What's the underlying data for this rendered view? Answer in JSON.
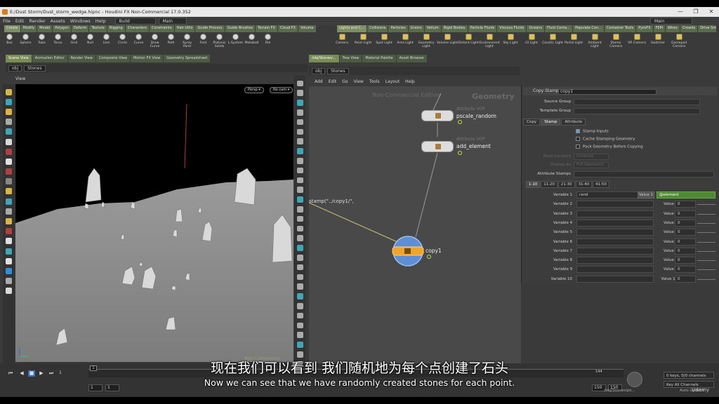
{
  "window": {
    "title": "E:/Dust Storm/Dust_storm_wedge.hipnc - Houdini FX Non-Commercial 17.0.352",
    "controls": [
      "—",
      "❐",
      "✕"
    ]
  },
  "menu": {
    "items": [
      "File",
      "Edit",
      "Render",
      "Assets",
      "Windows",
      "Help"
    ],
    "desktop": "Build",
    "desktop2": "Main"
  },
  "shelf_left": {
    "tabs": [
      "Create",
      "Modify",
      "Model",
      "Polygon",
      "Deform",
      "Texture",
      "Rigging",
      "Characters",
      "Constraints",
      "Hair Utils",
      "Guide Process",
      "Guide Brushes",
      "Terrain FX",
      "Cloud FX",
      "Volume"
    ],
    "tools": [
      "Box",
      "Sphere",
      "Tube",
      "Torus",
      "Grid",
      "Null",
      "Line",
      "Circle",
      "Curve",
      "Draw Curve",
      "Path",
      "Spray Paint",
      "Font",
      "Platonic Solids",
      "L-System",
      "Metaball",
      "File"
    ]
  },
  "shelf_right": {
    "tabs": [
      "Lights and C...",
      "Collisions",
      "Particles",
      "Grains",
      "Vellum",
      "Rigid Bodies",
      "Particle Fluids",
      "Viscous Fluids",
      "Oceans",
      "Fluid Conta...",
      "Populate Con...",
      "Container Tools",
      "PyroFX",
      "FEM",
      "Wires",
      "Crowds",
      "Drive Simula..."
    ],
    "tools": [
      "Camera",
      "Point Light",
      "Spot Light",
      "Area Light",
      "Geometry Light",
      "Volume Light",
      "Distant Light",
      "Environment Light",
      "Sky Light",
      "GI Light",
      "Caustic Light",
      "Portal Light",
      "Ambient Light",
      "Stereo Camera",
      "VR Camera",
      "Switcher",
      "Gamepad Camera"
    ]
  },
  "left_panes": {
    "tabs": [
      "Scene View",
      "Animation Editor",
      "Render View",
      "Composite View",
      "Motion FX View",
      "Geometry Spreadsheet"
    ],
    "path": [
      "obj",
      "Stones"
    ],
    "view_label": "View",
    "persp": "Persp ▾",
    "cam": "No cam ▾",
    "watermark": "Non-Commercial Edition"
  },
  "right_panes": {
    "tabs": [
      "/obj/Stones/...",
      "Tree View",
      "Material Palette",
      "Asset Browser"
    ],
    "path": [
      "obj",
      "Stones"
    ],
    "menu": [
      "Add",
      "Edit",
      "Go",
      "View",
      "Tools",
      "Layout",
      "Help"
    ]
  },
  "network": {
    "watermark": "Non-Commercial Edition",
    "context": "Geometry",
    "nodes": [
      {
        "type": "Attribute VOP",
        "name": "pscale_random"
      },
      {
        "type": "Attribute VOP",
        "name": "add_element"
      },
      {
        "type": "",
        "name": "copy1"
      }
    ],
    "expression": "stamp(\"../copy1/\","
  },
  "params": {
    "header": "Copy Stamp",
    "node_name": "copy1",
    "fields": [
      {
        "label": "Source Group",
        "value": ""
      },
      {
        "label": "Template Group",
        "value": ""
      }
    ],
    "tabs": [
      "Copy",
      "Stamp",
      "Attribute"
    ],
    "active_tab": "Stamp",
    "checks": [
      {
        "label": "Stamp Inputs",
        "on": true
      },
      {
        "label": "Cache Stamping Geometry",
        "on": false
      },
      {
        "label": "Pack Geometry Before Copying",
        "on": false
      }
    ],
    "faint": [
      {
        "label": "Pivot Location",
        "value": "Centroid"
      },
      {
        "label": "Display As",
        "value": "Full Geometry"
      }
    ],
    "attr_stamps": "Attribute Stamps",
    "range_tabs": [
      "1-10",
      "11-20",
      "21-30",
      "31-40",
      "41-50"
    ],
    "vars": [
      {
        "label": "Variable 1",
        "name": "rand",
        "vlabel": "Value 1",
        "value": "@element"
      },
      {
        "label": "Variable 2",
        "name": "",
        "vlabel": "Value 2",
        "value": "0"
      },
      {
        "label": "Variable 3",
        "name": "",
        "vlabel": "Value 3",
        "value": "0"
      },
      {
        "label": "Variable 4",
        "name": "",
        "vlabel": "Value 4",
        "value": "0"
      },
      {
        "label": "Variable 5",
        "name": "",
        "vlabel": "Value 5",
        "value": "0"
      },
      {
        "label": "Variable 6",
        "name": "",
        "vlabel": "Value 6",
        "value": "0"
      },
      {
        "label": "Variable 7",
        "name": "",
        "vlabel": "Value 7",
        "value": "0"
      },
      {
        "label": "Variable 8",
        "name": "",
        "vlabel": "Value 8",
        "value": "0"
      },
      {
        "label": "Variable 9",
        "name": "",
        "vlabel": "Value 9",
        "value": "0"
      },
      {
        "label": "Variable 10",
        "name": "",
        "vlabel": "Value 10",
        "value": "0"
      }
    ]
  },
  "timeline": {
    "frame": "1",
    "start": "1",
    "start2": "1",
    "end": "150",
    "end2": "150",
    "keys": "0 keys, 0/0 channels",
    "key_all": "Key All Channels",
    "ruler_mark": "144",
    "status": "/obj/Stones/po...",
    "auto_update": "Auto Update"
  },
  "subtitles": {
    "zh": "现在我们可以看到 我们随机地为每个点创建了石头",
    "en": "Now we can see that we have randomly created stones for each point."
  },
  "brand": "Udemy"
}
